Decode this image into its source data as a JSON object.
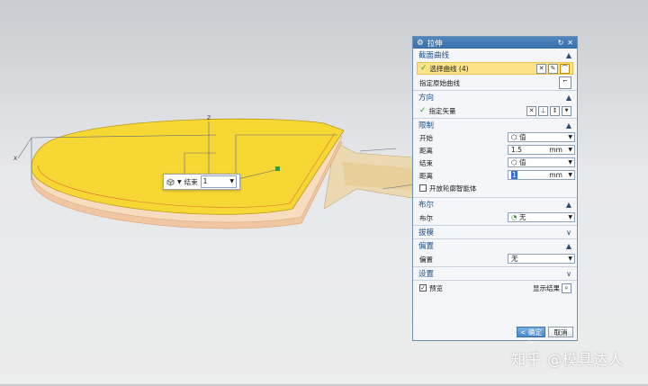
{
  "floating_toolbar": {
    "label": "结束",
    "value": "1"
  },
  "dialog": {
    "title": "拉伸",
    "sections": {
      "section_curve": {
        "title": "截面曲线",
        "select_curve": "选择曲线 (4)",
        "origin_curve": "指定原始曲线"
      },
      "direction": {
        "title": "方向",
        "specify_vector": "指定矢量"
      },
      "limits": {
        "title": "限制",
        "start_label": "开始",
        "start_value": "值",
        "distance1_label": "距离",
        "distance1_value": "1.5",
        "distance1_unit": "mm",
        "end_label": "结束",
        "end_value": "值",
        "distance2_label": "距离",
        "distance2_value": "1",
        "distance2_unit": "mm",
        "open_profile": "开放轮廓智能体"
      },
      "boolean": {
        "title": "布尔",
        "label": "布尔",
        "value": "无"
      },
      "draft": {
        "title": "拔模"
      },
      "offset": {
        "title": "偏置",
        "label": "偏置",
        "value": "无"
      },
      "settings": {
        "title": "设置"
      }
    },
    "preview_label": "预览",
    "show_result": "显示结果",
    "ok": "< 确定 >",
    "cancel": "取消"
  },
  "watermark": "知乎 @模具达人",
  "colors": {
    "paddle": "#f7d733",
    "title_bar": "#3f78b2",
    "highlight": "#fce38a",
    "section_text": "#1b4f8a"
  }
}
